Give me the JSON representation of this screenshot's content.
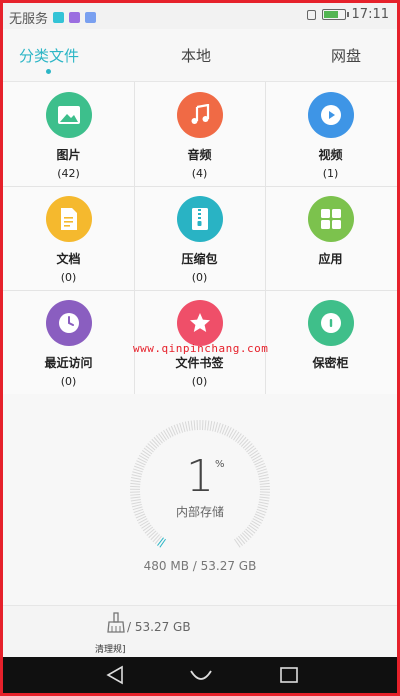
{
  "status_bar": {
    "carrier": "无服务",
    "time": "17:11",
    "icon_colors": [
      "#33c3d6",
      "#9b6ee0",
      "#7aa0f0"
    ]
  },
  "tabs": [
    {
      "label": "分类文件",
      "active": true
    },
    {
      "label": "本地",
      "active": false
    },
    {
      "label": "网盘",
      "active": false
    }
  ],
  "categories": [
    {
      "label": "图片",
      "count": "(42)",
      "icon": "image-icon",
      "color": "#3dbf8c"
    },
    {
      "label": "音频",
      "count": "(4)",
      "icon": "music-icon",
      "color": "#f06a45"
    },
    {
      "label": "视频",
      "count": "(1)",
      "icon": "video-icon",
      "color": "#3e95e6"
    },
    {
      "label": "文档",
      "count": "(0)",
      "icon": "document-icon",
      "color": "#f5b92e"
    },
    {
      "label": "压缩包",
      "count": "(0)",
      "icon": "archive-icon",
      "color": "#29b3c4"
    },
    {
      "label": "应用",
      "count": "",
      "icon": "apps-icon",
      "color": "#7cc24d"
    },
    {
      "label": "最近访问",
      "count": "(0)",
      "icon": "clock-icon",
      "color": "#8a5ec0"
    },
    {
      "label": "文件书签",
      "count": "(0)",
      "icon": "star-icon",
      "color": "#ef4f69"
    },
    {
      "label": "保密柜",
      "count": "",
      "icon": "safe-icon",
      "color": "#3fbf8a"
    }
  ],
  "storage": {
    "percent": "1",
    "percent_sign": "%",
    "label": "内部存储",
    "usage": "480 MB / 53.27 GB"
  },
  "cleanup": {
    "text": "/ 53.27 GB",
    "label": "清理规]"
  },
  "watermark": "www.qinpinchang.com",
  "navbar": {
    "buttons": [
      "back-icon",
      "home-icon",
      "recent-apps-icon"
    ]
  }
}
